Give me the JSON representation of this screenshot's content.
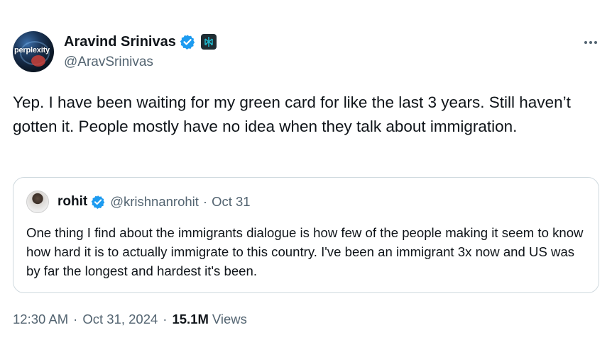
{
  "author": {
    "display_name": "Aravind Srinivas",
    "handle": "@AravSrinivas",
    "avatar_text": "perplexity",
    "verified_icon": "verified-badge-icon",
    "affiliation_icon": "perplexity-affiliate-icon"
  },
  "more_icon": "more-options-icon",
  "tweet": {
    "text": "Yep. I have been waiting for my green card for like the last 3 years. Still haven’t gotten it. People mostly have no idea when they talk about immigration."
  },
  "quoted": {
    "display_name": "rohit",
    "handle": "@krishnanrohit",
    "separator": "·",
    "date": "Oct 31",
    "text": "One thing I find about the immigrants dialogue is how few of the people making it seem to know how hard it is to actually immigrate to this country. I've been an immigrant 3x now and US was by far the longest and hardest it's been."
  },
  "meta": {
    "time": "12:30 AM",
    "separator": "·",
    "date": "Oct 31, 2024",
    "views_count": "15.1M",
    "views_label": "Views"
  },
  "colors": {
    "text_primary": "#0f1419",
    "text_secondary": "#536471",
    "verified_blue": "#1d9bf0",
    "border": "#cfd9de"
  }
}
